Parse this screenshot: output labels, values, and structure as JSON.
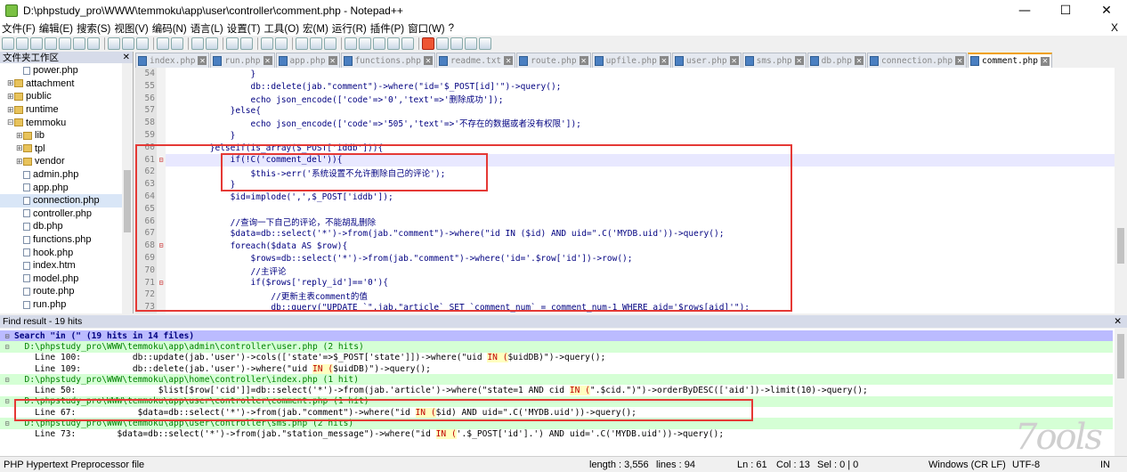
{
  "window": {
    "title": "D:\\phpstudy_pro\\WWW\\temmoku\\app\\user\\controller\\comment.php - Notepad++",
    "minimize": "—",
    "maximize": "☐",
    "close": "✕"
  },
  "menu": {
    "items": [
      "文件(F)",
      "编辑(E)",
      "搜索(S)",
      "视图(V)",
      "编码(N)",
      "语言(L)",
      "设置(T)",
      "工具(O)",
      "宏(M)",
      "运行(R)",
      "插件(P)",
      "窗口(W)",
      "?"
    ],
    "close": "X"
  },
  "file_panel": {
    "title": "文件夹工作区",
    "close": "✕",
    "items": [
      {
        "label": "power.php",
        "type": "file",
        "indent": 1,
        "toggle": ""
      },
      {
        "label": "attachment",
        "type": "folder",
        "indent": 0,
        "toggle": "⊞"
      },
      {
        "label": "public",
        "type": "folder",
        "indent": 0,
        "toggle": "⊞"
      },
      {
        "label": "runtime",
        "type": "folder",
        "indent": 0,
        "toggle": "⊞"
      },
      {
        "label": "temmoku",
        "type": "folder",
        "indent": 0,
        "toggle": "⊟"
      },
      {
        "label": "lib",
        "type": "folder",
        "indent": 1,
        "toggle": "⊞"
      },
      {
        "label": "tpl",
        "type": "folder",
        "indent": 1,
        "toggle": "⊞"
      },
      {
        "label": "vendor",
        "type": "folder",
        "indent": 1,
        "toggle": "⊞"
      },
      {
        "label": "admin.php",
        "type": "file",
        "indent": 1,
        "toggle": ""
      },
      {
        "label": "app.php",
        "type": "file",
        "indent": 1,
        "toggle": ""
      },
      {
        "label": "connection.php",
        "type": "file",
        "indent": 1,
        "toggle": "",
        "selected": true
      },
      {
        "label": "controller.php",
        "type": "file",
        "indent": 1,
        "toggle": ""
      },
      {
        "label": "db.php",
        "type": "file",
        "indent": 1,
        "toggle": ""
      },
      {
        "label": "functions.php",
        "type": "file",
        "indent": 1,
        "toggle": ""
      },
      {
        "label": "hook.php",
        "type": "file",
        "indent": 1,
        "toggle": ""
      },
      {
        "label": "index.htm",
        "type": "file",
        "indent": 1,
        "toggle": ""
      },
      {
        "label": "model.php",
        "type": "file",
        "indent": 1,
        "toggle": ""
      },
      {
        "label": "route.php",
        "type": "file",
        "indent": 1,
        "toggle": ""
      },
      {
        "label": "run.php",
        "type": "file",
        "indent": 1,
        "toggle": ""
      }
    ]
  },
  "tabs": [
    {
      "label": "index.php",
      "active": false
    },
    {
      "label": "run.php",
      "active": false
    },
    {
      "label": "app.php",
      "active": false
    },
    {
      "label": "functions.php",
      "active": false
    },
    {
      "label": "readme.txt",
      "active": false
    },
    {
      "label": "route.php",
      "active": false
    },
    {
      "label": "upfile.php",
      "active": false
    },
    {
      "label": "user.php",
      "active": false
    },
    {
      "label": "sms.php",
      "active": false
    },
    {
      "label": "db.php",
      "active": false
    },
    {
      "label": "connection.php",
      "active": false
    },
    {
      "label": "comment.php",
      "active": true
    }
  ],
  "editor": {
    "lines": [
      {
        "num": "54",
        "fold": "",
        "code": "                }",
        "current": false
      },
      {
        "num": "55",
        "fold": "",
        "code": "                db::delete(jab.\"comment\")->where(\"id='$_POST[id]'\")->query();",
        "current": false
      },
      {
        "num": "56",
        "fold": "",
        "code": "                echo json_encode(['code'=>'0','text'=>'删除成功']);",
        "current": false
      },
      {
        "num": "57",
        "fold": "",
        "code": "            }else{",
        "current": false
      },
      {
        "num": "58",
        "fold": "",
        "code": "                echo json_encode(['code'=>'505','text'=>'不存在的数据或者没有权限']);",
        "current": false
      },
      {
        "num": "59",
        "fold": "",
        "code": "            }",
        "current": false
      },
      {
        "num": "60",
        "fold": "",
        "code": "        }elseif(is_array($_POST['iddb'])){",
        "current": false
      },
      {
        "num": "61",
        "fold": "⊟",
        "code": "            if(!C('comment_del')){",
        "current": true
      },
      {
        "num": "62",
        "fold": "",
        "code": "                $this->err('系统设置不允许删除自己的评论');",
        "current": false
      },
      {
        "num": "63",
        "fold": "",
        "code": "            }",
        "current": false
      },
      {
        "num": "64",
        "fold": "",
        "code": "            $id=implode(',',$_POST['iddb']);",
        "current": false
      },
      {
        "num": "65",
        "fold": "",
        "code": "",
        "current": false
      },
      {
        "num": "66",
        "fold": "",
        "code": "            //查询一下自己的评论，不能胡乱删除",
        "current": false
      },
      {
        "num": "67",
        "fold": "",
        "code": "            $data=db::select('*')->from(jab.\"comment\")->where(\"id IN ($id) AND uid=\".C('MYDB.uid'))->query();",
        "current": false
      },
      {
        "num": "68",
        "fold": "⊟",
        "code": "            foreach($data AS $row){",
        "current": false
      },
      {
        "num": "69",
        "fold": "",
        "code": "                $rows=db::select('*')->from(jab.\"comment\")->where('id='.$row['id'])->row();",
        "current": false
      },
      {
        "num": "70",
        "fold": "",
        "code": "                //主评论",
        "current": false
      },
      {
        "num": "71",
        "fold": "⊟",
        "code": "                if($rows['reply_id']=='0'){",
        "current": false
      },
      {
        "num": "72",
        "fold": "",
        "code": "                    //更新主表comment的值",
        "current": false
      },
      {
        "num": "73",
        "fold": "",
        "code": "                    db::query(\"UPDATE `\".jab.\"article` SET `comment_num` = comment_num-1 WHERE aid='$rows[aid]'\");",
        "current": false
      }
    ]
  },
  "find_result": {
    "header": "Find result - 19 hits",
    "close": "✕",
    "rows": [
      {
        "type": "search",
        "fg": "⊟",
        "pre": "Search \"in (\" (19 hits in 14 files)",
        "kw": "",
        "post": ""
      },
      {
        "type": "file",
        "fg": "⊟",
        "pre": "  D:\\phpstudy_pro\\WWW\\temmoku\\app\\admin\\controller\\user.php (2 hits)",
        "kw": "",
        "post": ""
      },
      {
        "type": "line",
        "fg": "",
        "pre": "    Line 100:          db::update(jab.'user')->cols(['state'=>$_POST['state']])->where(\"uid ",
        "kw": "IN (",
        "post": "$uidDB)\")->query();"
      },
      {
        "type": "line",
        "fg": "",
        "pre": "    Line 109:          db::delete(jab.'user')->where(\"uid ",
        "kw": "IN (",
        "post": "$uidDB)\")->query();"
      },
      {
        "type": "file",
        "fg": "⊟",
        "pre": "  D:\\phpstudy_pro\\WWW\\temmoku\\app\\home\\controller\\index.php (1 hit)",
        "kw": "",
        "post": ""
      },
      {
        "type": "line",
        "fg": "",
        "pre": "    Line 50:                $list[$row['cid']]=db::select('*')->from(jab.'article')->where(\"state=1 AND cid ",
        "kw": "IN (",
        "post": "\".$cid.\")\")->orderByDESC(['aid'])->limit(10)->query();"
      },
      {
        "type": "file",
        "fg": "⊟",
        "pre": "  D:\\phpstudy_pro\\WWW\\temmoku\\app\\user\\controller\\comment.php (1 hit)",
        "kw": "",
        "post": ""
      },
      {
        "type": "line",
        "fg": "",
        "pre": "    Line 67:            $data=db::select('*')->from(jab.\"comment\")->where(\"id ",
        "kw": "IN (",
        "post": "$id) AND uid=\".C('MYDB.uid'))->query();"
      },
      {
        "type": "file",
        "fg": "⊟",
        "pre": "  D:\\phpstudy_pro\\WWW\\temmoku\\app\\user\\controller\\sms.php (2 hits)",
        "kw": "",
        "post": ""
      },
      {
        "type": "line",
        "fg": "",
        "pre": "    Line 73:        $data=db::select('*')->from(jab.\"station_message\")->where(\"id ",
        "kw": "IN (",
        "post": "'.$_POST['id'].') AND uid='.C('MYDB.uid'))->query();"
      }
    ]
  },
  "status": {
    "lang": "PHP Hypertext Preprocessor file",
    "length": "length : 3,556",
    "lines": "lines : 94",
    "ln": "Ln : 61",
    "col": "Col : 13",
    "sel": "Sel : 0 | 0",
    "eol": "Windows (CR LF)",
    "enc": "UTF-8",
    "mode": "IN"
  },
  "watermark": "7ools"
}
